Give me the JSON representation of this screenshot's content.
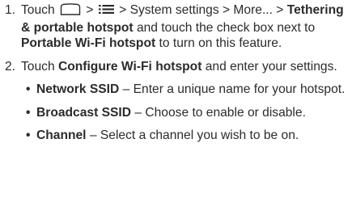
{
  "steps": [
    {
      "number": "1.",
      "touch": "Touch",
      "sep1": ">",
      "sep2": ">",
      "system_settings": "System settings",
      "sep3": ">",
      "more": "More...",
      "sep4": ">",
      "tethering": "Tethering & portable hotspot",
      "and_touch": "and touch the check box next to",
      "portable": "Portable Wi-Fi hotspot",
      "to_turn_on": "to turn on this feature.",
      "icons": [
        "home-icon",
        "menu-icon"
      ]
    },
    {
      "number": "2.",
      "touch": "Touch",
      "configure": "Configure Wi-Fi hotspot",
      "and_enter": "and enter your settings."
    }
  ],
  "bullets": [
    {
      "term": "Network SSID",
      "dash": "–",
      "desc": "Enter a unique name for your hotspot."
    },
    {
      "term": "Broadcast SSID",
      "dash": "–",
      "desc": "Choose to enable or disable."
    },
    {
      "term": "Channel",
      "dash": "–",
      "desc": "Select a channel you wish to be on."
    }
  ]
}
